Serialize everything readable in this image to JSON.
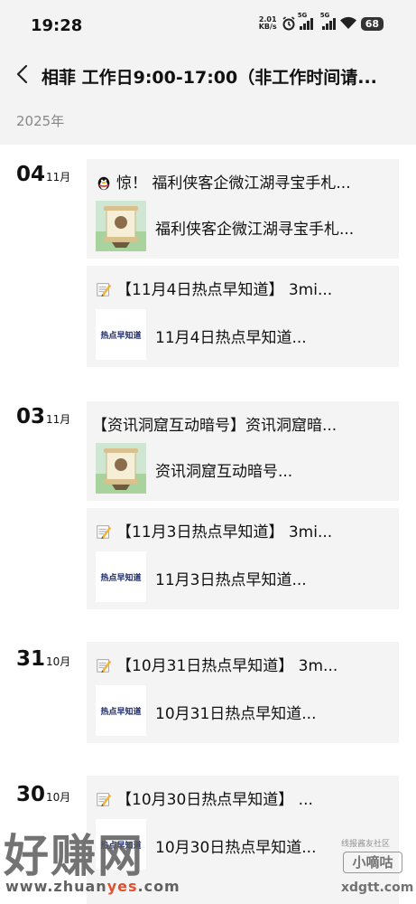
{
  "status_bar": {
    "time": "19:28",
    "net_speed_value": "2.01",
    "net_speed_unit": "KB/s",
    "sim1_label": "5G",
    "sim2_label": "5G",
    "battery": "68"
  },
  "header": {
    "title": "相菲 工作日9:00-17:00（非工作时间请..."
  },
  "year_label": "2025年",
  "groups": [
    {
      "day": "04",
      "month": "11月",
      "cards": [
        {
          "title": "惊！ 福利侠客企微江湖寻宝手札...",
          "desc": "福利侠客企微江湖寻宝手札...",
          "thumb": "scroll-illustration",
          "emoji": "qq-penguin-icon"
        },
        {
          "title": "【11月4日热点早知道】 3mi...",
          "desc": "11月4日热点早知道...",
          "thumb": "热点早知道",
          "emoji": "memo-icon"
        }
      ]
    },
    {
      "day": "03",
      "month": "11月",
      "cards": [
        {
          "title": "【资讯洞窟互动暗号】资讯洞窟暗...",
          "desc": "资讯洞窟互动暗号...",
          "thumb": "scroll-illustration"
        },
        {
          "title": "【11月3日热点早知道】 3mi...",
          "desc": "11月3日热点早知道...",
          "thumb": "热点早知道",
          "emoji": "memo-icon"
        }
      ]
    },
    {
      "day": "31",
      "month": "10月",
      "cards": [
        {
          "title": "【10月31日热点早知道】 3m...",
          "desc": "10月31日热点早知道...",
          "thumb": "热点早知道",
          "emoji": "memo-icon"
        }
      ]
    },
    {
      "day": "30",
      "month": "10月",
      "cards": [
        {
          "title": "【10月30日热点早知道】 ...",
          "desc": "10月30日热点早知道...",
          "thumb": "热点早知道",
          "emoji": "memo-icon"
        }
      ]
    }
  ],
  "watermarks": {
    "left_big": "好赚网",
    "left_url_a": "www.zhuan",
    "left_url_b": "yes",
    "left_url_c": ".com",
    "right_top": "线报酱友社区",
    "right_box": "小嘀咕",
    "right_url": "xdgtt.com"
  }
}
